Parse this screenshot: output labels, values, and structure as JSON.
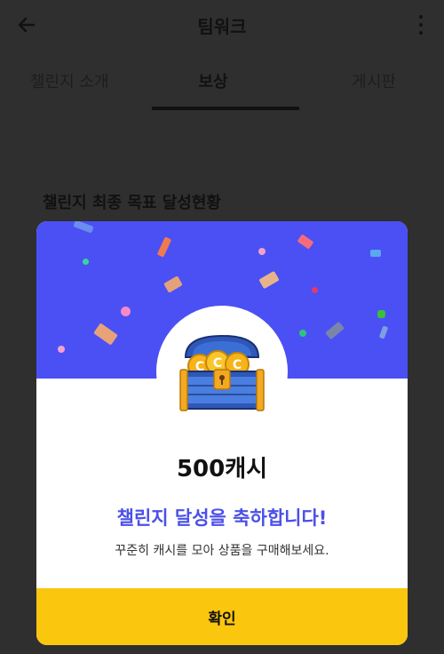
{
  "header": {
    "title": "팀워크"
  },
  "tabs": [
    {
      "label": "챌린지 소개"
    },
    {
      "label": "보상"
    },
    {
      "label": "게시판"
    }
  ],
  "section": {
    "title": "챌린지 최종 목표 달성현황"
  },
  "modal": {
    "reward_amount": "500캐시",
    "congrats": "챌린지 달성을 축하합니다!",
    "description": "꾸준히 캐시를 모아 상품을 구매해보세요.",
    "confirm_label": "확인"
  },
  "colors": {
    "banner": "#4b50f4",
    "confirm": "#fbc60e",
    "congrats_text": "#4b50e8"
  },
  "icons": {
    "back": "arrow-left-icon",
    "more": "more-vertical-icon",
    "chest": "treasure-chest-icon"
  }
}
